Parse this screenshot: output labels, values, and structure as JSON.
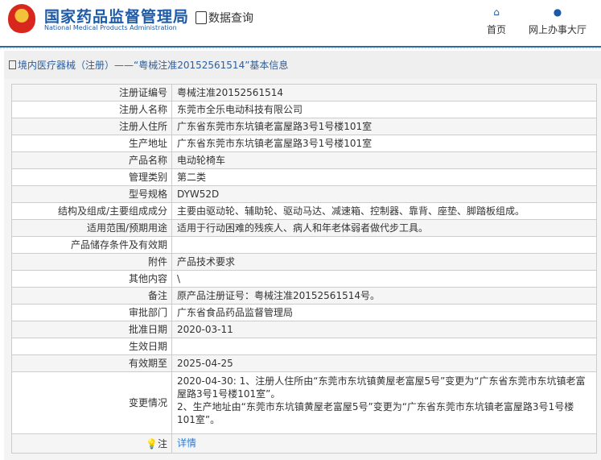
{
  "header": {
    "brand_cn": "国家药品监督管理局",
    "brand_en": "National Medical Products Administration",
    "data_query": "数据查询",
    "nav": [
      {
        "label": "首页",
        "icon": "home-icon"
      },
      {
        "label": "网上办事大厅",
        "icon": "user-icon"
      }
    ]
  },
  "panel": {
    "title": "境内医疗器械（注册）——“粤械注准20152561514”基本信息"
  },
  "rows": [
    {
      "label": "注册证编号",
      "value": "粤械注准20152561514"
    },
    {
      "label": "注册人名称",
      "value": "东莞市全乐电动科技有限公司"
    },
    {
      "label": "注册人住所",
      "value": "广东省东莞市东坑镇老富屋路3号1号楼101室"
    },
    {
      "label": "生产地址",
      "value": "广东省东莞市东坑镇老富屋路3号1号楼101室"
    },
    {
      "label": "产品名称",
      "value": "电动轮椅车"
    },
    {
      "label": "管理类别",
      "value": "第二类"
    },
    {
      "label": "型号规格",
      "value": "DYW52D"
    },
    {
      "label": "结构及组成/主要组成成分",
      "value": "主要由驱动轮、辅助轮、驱动马达、减速箱、控制器、靠背、座垫、脚踏板组成。"
    },
    {
      "label": "适用范围/预期用途",
      "value": "适用于行动困难的残疾人、病人和年老体弱者做代步工具。"
    },
    {
      "label": "产品储存条件及有效期",
      "value": ""
    },
    {
      "label": "附件",
      "value": "产品技术要求"
    },
    {
      "label": "其他内容",
      "value": "\\"
    },
    {
      "label": "备注",
      "value": "原产品注册证号：粤械注准20152561514号。"
    },
    {
      "label": "审批部门",
      "value": "广东省食品药品监督管理局"
    },
    {
      "label": "批准日期",
      "value": "2020-03-11"
    },
    {
      "label": "生效日期",
      "value": ""
    },
    {
      "label": "有效期至",
      "value": "2025-04-25"
    }
  ],
  "changes": {
    "label": "变更情况",
    "line1": "2020-04-30: 1、注册人住所由“东莞市东坑镇黄屋老富屋5号”变更为“广东省东莞市东坑镇老富屋路3号1号楼101室”。",
    "line2": "2、生产地址由“东莞市东坑镇黄屋老富屋5号”变更为“广东省东莞市东坑镇老富屋路3号1号楼101室”。"
  },
  "note": {
    "label": "注",
    "link": "详情"
  }
}
